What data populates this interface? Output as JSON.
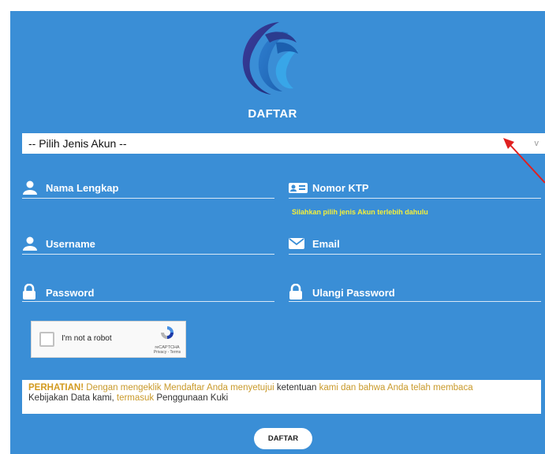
{
  "form": {
    "title": "DAFTAR",
    "account_type_select": {
      "value": "-- Pilih Jenis Akun --"
    },
    "fields": {
      "full_name": "Nama Lengkap",
      "ktp": "Nomor KTP",
      "ktp_hint": "Silahkan pilih jenis Akun terlebih dahulu",
      "username": "Username",
      "email": "Email",
      "password": "Password",
      "confirm_password": "Ulangi Password"
    },
    "captcha": {
      "label": "I'm not a robot",
      "brand": "reCAPTCHA",
      "links": "Privacy - Terms"
    },
    "notice": {
      "warning": "PERHATIAN!",
      "p1": " Dengan mengeklik Mendaftar Anda menyetujui ",
      "p2": "ketentuan",
      "p3": " kami dan bahwa Anda telah membaca",
      "p4": "Kebijakan Data kami, ",
      "p5": "termasuk",
      "p6": " Penggunaan Kuki"
    },
    "submit_label": "DAFTAR"
  },
  "colors": {
    "panel_bg": "#3a8ed6",
    "hint": "#f4ef3a",
    "warning": "#d29a1f",
    "annotation_arrow": "#e02020"
  },
  "icons": {
    "logo": "kominfo-logo",
    "select_chevron": "chevron-down-icon",
    "full_name": "user-icon",
    "ktp": "id-card-icon",
    "username": "user-icon",
    "email": "envelope-icon",
    "password": "lock-icon",
    "confirm_password": "lock-icon",
    "captcha": "recaptcha-icon"
  }
}
